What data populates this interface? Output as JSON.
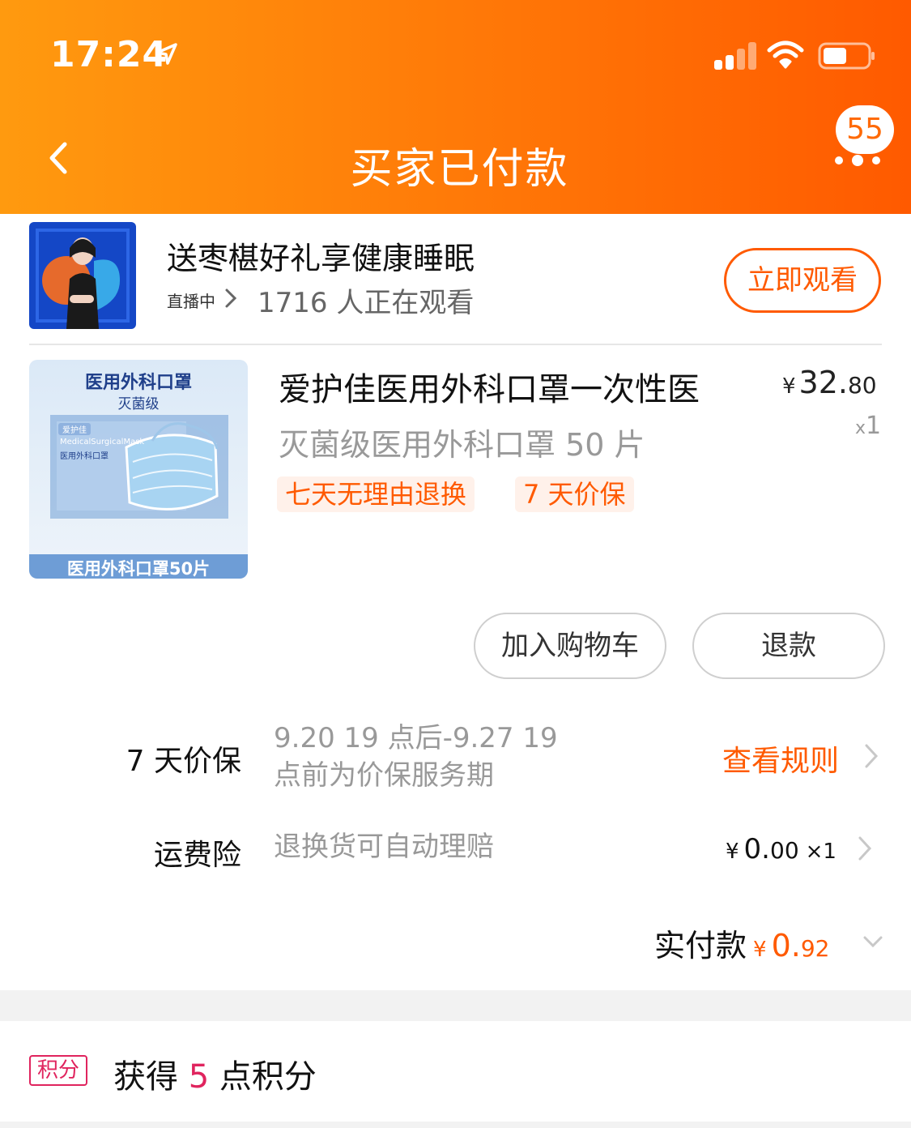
{
  "status_bar": {
    "time": "17:24"
  },
  "header": {
    "title": "买家已付款",
    "message_count": "55"
  },
  "live": {
    "title": "送枣椹好礼享健康睡眠",
    "status": "直播中",
    "viewers": "1716 人正在观看",
    "watch_button": "立即观看"
  },
  "product": {
    "title": "爱护佳医用外科口罩一次性医",
    "sku": "灭菌级医用外科口罩 50 片",
    "price_currency": "¥",
    "price_int": "32.",
    "price_dec": "80",
    "qty_prefix": "x",
    "qty": "1",
    "tags": [
      "七天无理由退换",
      "7 天价保"
    ],
    "image_text": {
      "line1": "医用外科口罩",
      "line2": "灭菌级",
      "brand": "爱护佳",
      "en": "MedicalSurgicalMask",
      "small": "医用外科口罩",
      "footer": "医用外科口罩50片"
    }
  },
  "actions": {
    "add_to_cart": "加入购物车",
    "refund": "退款"
  },
  "price_protect": {
    "label": "7 天价保",
    "desc_line1": "9.20 19 点后-9.27 19",
    "desc_line2": "点前为价保服务期",
    "link": "查看规则"
  },
  "shipping_insurance": {
    "label": "运费险",
    "desc": "退换货可自动理赔",
    "currency": "¥",
    "int": "0.",
    "dec": "00",
    "qty": "×1"
  },
  "total": {
    "label": "实付款",
    "currency": "¥",
    "int": "0.",
    "dec": "92"
  },
  "points": {
    "badge": "积分",
    "prefix": "获得 ",
    "value": "5",
    "suffix": " 点积分"
  },
  "colors": {
    "accent": "#ff5a00",
    "header_start": "#ff9a0f",
    "points": "#e0245e"
  }
}
